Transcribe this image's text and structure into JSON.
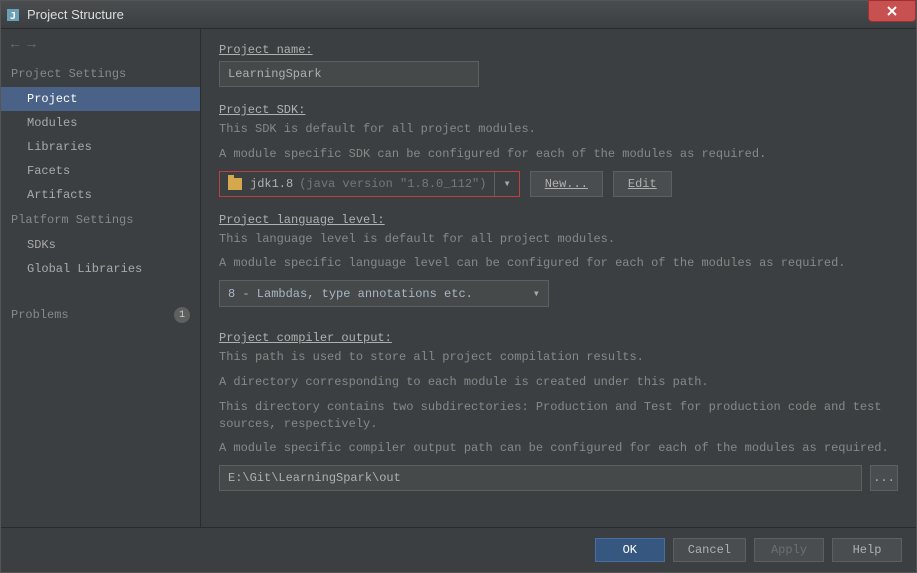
{
  "window": {
    "title": "Project Structure"
  },
  "sidebar": {
    "headers": {
      "project_settings": "Project Settings",
      "platform_settings": "Platform Settings"
    },
    "items": {
      "project": "Project",
      "modules": "Modules",
      "libraries": "Libraries",
      "facets": "Facets",
      "artifacts": "Artifacts",
      "sdks": "SDKs",
      "global_libraries": "Global Libraries"
    },
    "problems": {
      "label": "Problems",
      "count": "1"
    }
  },
  "project_name": {
    "label": "Project name:",
    "value": "LearningSpark"
  },
  "project_sdk": {
    "label": "Project SDK:",
    "desc1": "This SDK is default for all project modules.",
    "desc2": "A module specific SDK can be configured for each of the modules as required.",
    "sdk_name": "jdk1.8",
    "sdk_version": "(java version \"1.8.0_112\")",
    "new_btn": "New...",
    "edit_btn": "Edit"
  },
  "language_level": {
    "label": "Project language level:",
    "desc1": "This language level is default for all project modules.",
    "desc2": "A module specific language level can be configured for each of the modules as required.",
    "value": "8 - Lambdas, type annotations etc."
  },
  "compiler_output": {
    "label": "Project compiler output:",
    "desc1": "This path is used to store all project compilation results.",
    "desc2": "A directory corresponding to each module is created under this path.",
    "desc3": "This directory contains two subdirectories: Production and Test for production code and test sources, respectively.",
    "desc4": "A module specific compiler output path can be configured for each of the modules as required.",
    "value": "E:\\Git\\LearningSpark\\out",
    "browse": "..."
  },
  "footer": {
    "ok": "OK",
    "cancel": "Cancel",
    "apply": "Apply",
    "help": "Help"
  }
}
